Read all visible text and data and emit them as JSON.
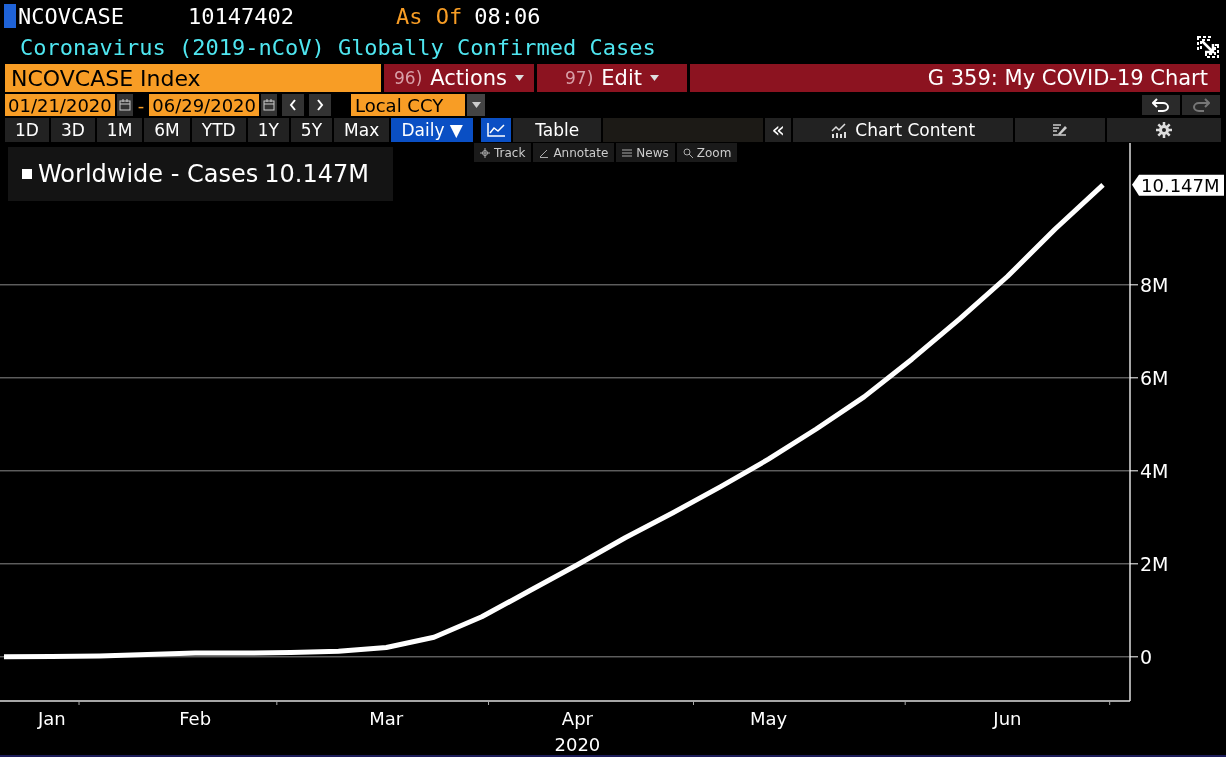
{
  "header": {
    "ticker": "NCOVCASE",
    "value": "10147402",
    "as_of_label": "As Of",
    "time": "08:06",
    "title": "Coronavirus (2019-nCoV) Globally Confirmed Cases"
  },
  "command_bar": {
    "security": "NCOVCASE Index",
    "actions": [
      {
        "number": "96)",
        "label": "Actions"
      },
      {
        "number": "97)",
        "label": "Edit"
      }
    ],
    "chart_name": "G 359: My COVID-19 Chart"
  },
  "range": {
    "start": "01/21/2020",
    "separator": "-",
    "end": "06/29/2020",
    "currency": "Local CCY"
  },
  "periods": [
    "1D",
    "3D",
    "1M",
    "6M",
    "YTD",
    "1Y",
    "5Y",
    "Max"
  ],
  "frequency": "Daily ▼",
  "chart_type": {
    "selected": true
  },
  "table_button": "Table",
  "collapse_button": "«",
  "chart_content": "Chart Content",
  "chart_tools": [
    "Track",
    "Annotate",
    "News",
    "Zoom"
  ],
  "legend": {
    "value": "10.147M"
  },
  "last_value_tag": "10.147M",
  "chart_data": {
    "type": "line",
    "xlabel": "2020",
    "grid": true,
    "categories": [
      null,
      "Jan",
      null,
      null,
      "Feb",
      null,
      null,
      null,
      "Mar",
      null,
      null,
      null,
      "Apr",
      null,
      null,
      null,
      "May",
      null,
      null,
      null,
      null,
      "Jun",
      null,
      null
    ],
    "series": [
      {
        "name": "Worldwide - Cases",
        "color": "#ffffff",
        "values": [
          0,
          0.01,
          0.02,
          0.05,
          0.08,
          0.08,
          0.09,
          0.12,
          0.2,
          0.42,
          0.86,
          1.42,
          1.98,
          2.56,
          3.1,
          3.66,
          4.25,
          4.9,
          5.59,
          6.4,
          7.27,
          8.18,
          9.2,
          10.15
        ]
      }
    ],
    "ylim": [
      -0.95,
      11.05
    ],
    "yticks": [
      {
        "value": 0,
        "label": "0"
      },
      {
        "value": 2,
        "label": "2M"
      },
      {
        "value": 4,
        "label": "4M"
      },
      {
        "value": 6,
        "label": "6M"
      },
      {
        "value": 8,
        "label": "8M"
      }
    ]
  }
}
